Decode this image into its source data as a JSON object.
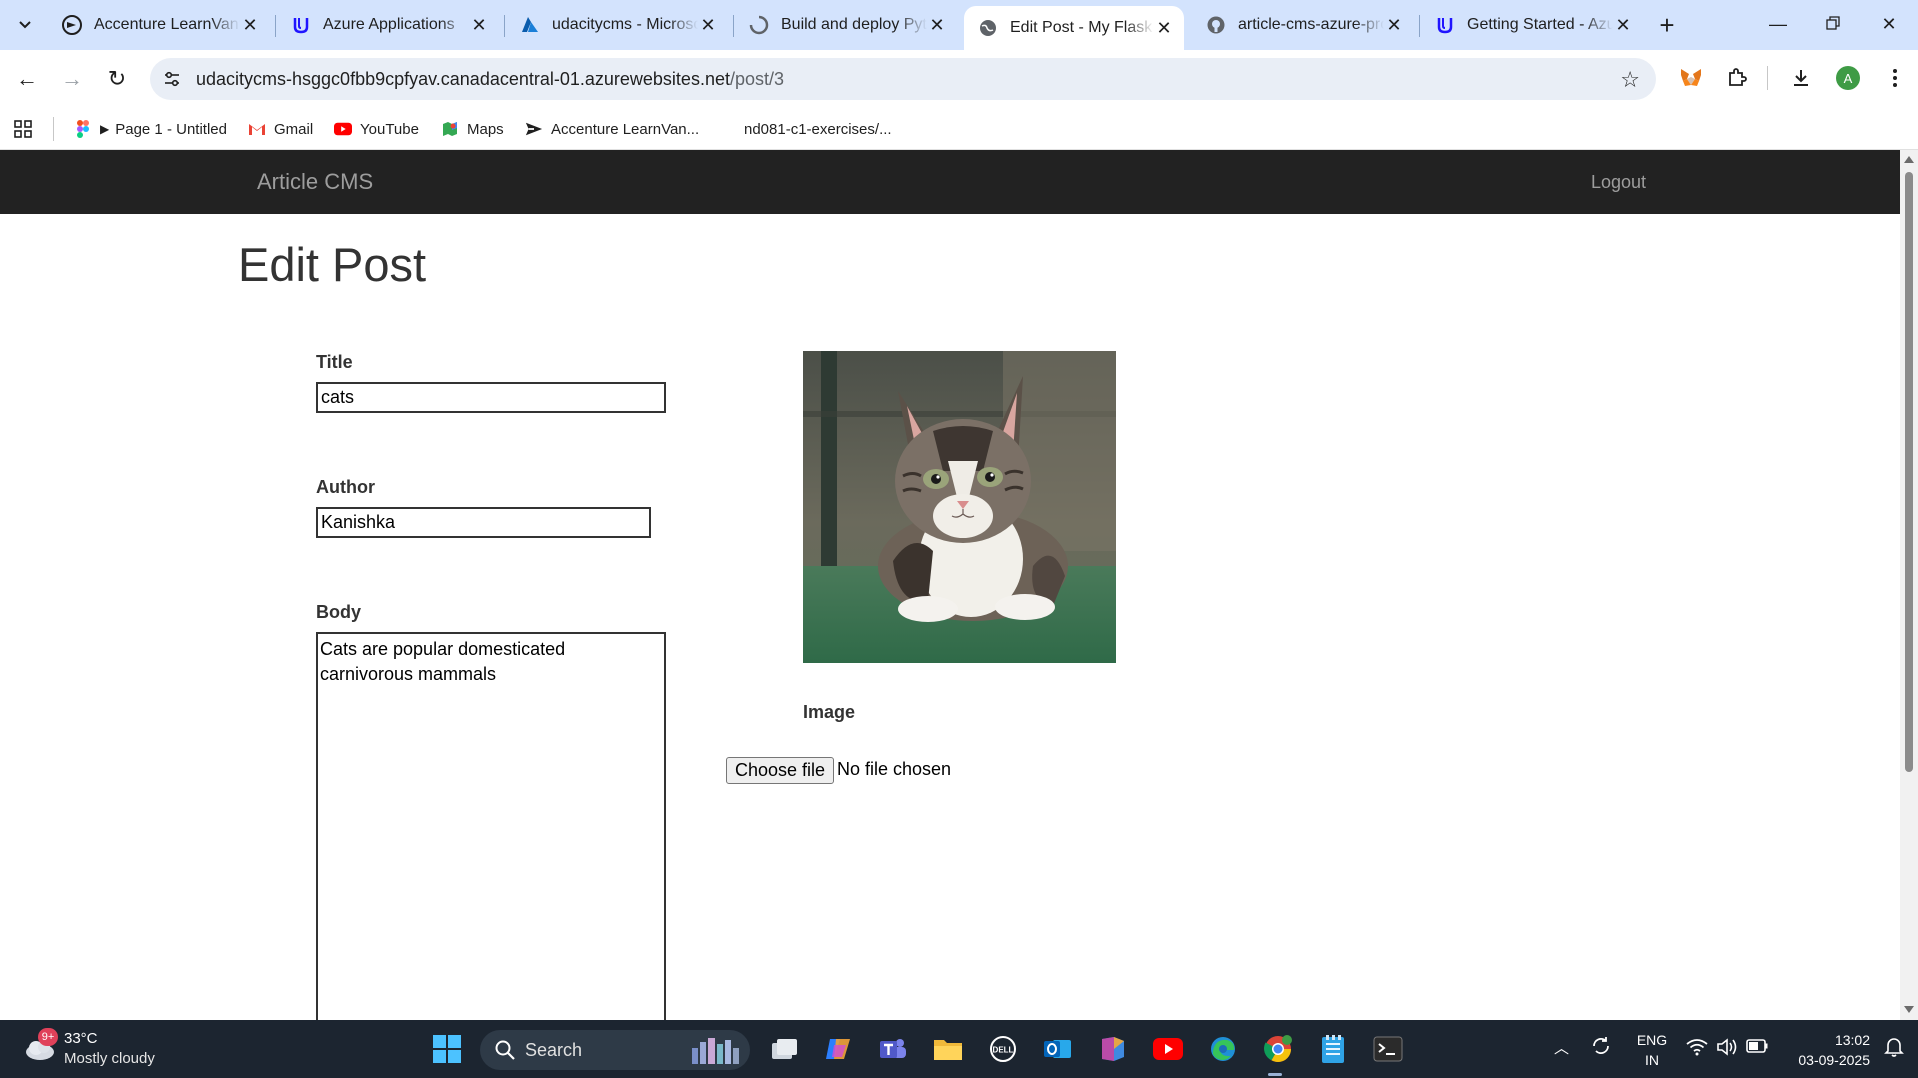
{
  "browser": {
    "tabs": [
      {
        "title": "Accenture LearnVantage",
        "icon": "accenture-icon"
      },
      {
        "title": "Azure Applications",
        "icon": "udacity-icon"
      },
      {
        "title": "udacitycms - Microsoft Azure",
        "icon": "azure-icon"
      },
      {
        "title": "Build and deploy Python",
        "icon": "loading-icon"
      },
      {
        "title": "Edit Post - My Flask App",
        "icon": "globe-icon",
        "active": true
      },
      {
        "title": "article-cms-azure-project",
        "icon": "github-icon"
      },
      {
        "title": "Getting Started - Azure",
        "icon": "udacity-icon"
      }
    ],
    "url_host": "udacitycms-hsggc0fbb9cpfyav.canadacentral-01.azurewebsites.net",
    "url_path": "/post/3",
    "profile_initial": "A",
    "bookmarks": [
      {
        "label": "Page 1 - Untitled",
        "icon": "figma-icon"
      },
      {
        "label": "Gmail",
        "icon": "gmail-icon"
      },
      {
        "label": "YouTube",
        "icon": "youtube-icon"
      },
      {
        "label": "Maps",
        "icon": "maps-icon"
      },
      {
        "label": "Accenture LearnVan...",
        "icon": "accenture-icon"
      },
      {
        "label": "nd081-c1-exercises/...",
        "icon": "github-icon"
      }
    ]
  },
  "page": {
    "brand": "Article CMS",
    "logout": "Logout",
    "heading": "Edit Post",
    "form": {
      "title_label": "Title",
      "title_value": "cats",
      "author_label": "Author",
      "author_value": "Kanishka",
      "body_label": "Body",
      "body_value": "Cats are popular domesticated carnivorous mammals",
      "image_label": "Image",
      "file_button": "Choose file",
      "file_status": "No file chosen"
    }
  },
  "taskbar": {
    "weather_badge": "9+",
    "temperature": "33°C",
    "condition": "Mostly cloudy",
    "search_placeholder": "Search",
    "language": "ENG",
    "region": "IN",
    "time": "13:02",
    "date": "03-09-2025"
  },
  "colors": {
    "tabstrip": "#d3e3fd",
    "navbar": "#222222",
    "navbar_text": "#9d9d9d",
    "taskbar": "#1c2530"
  }
}
